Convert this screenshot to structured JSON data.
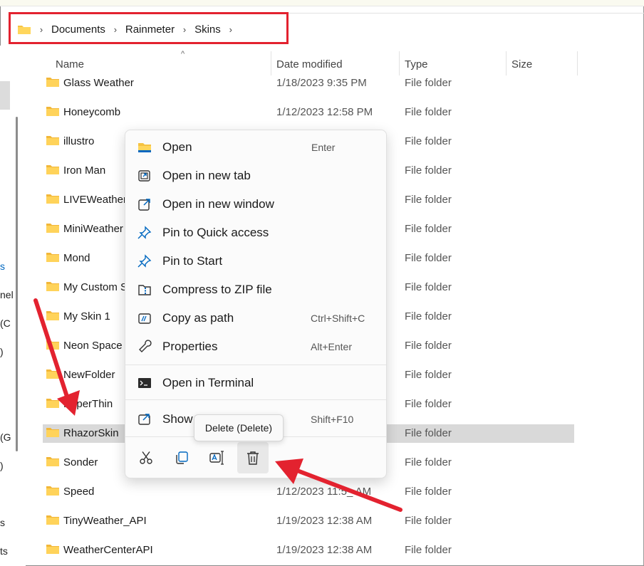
{
  "breadcrumb": {
    "items": [
      "Documents",
      "Rainmeter",
      "Skins"
    ]
  },
  "columns": {
    "name": "Name",
    "date": "Date modified",
    "type": "Type",
    "size": "Size"
  },
  "left_fragments": [
    "s",
    "nel",
    "(C",
    ")",
    "(G",
    ")",
    "s",
    "ts"
  ],
  "rows": [
    {
      "name": "Glass Weather",
      "date": "1/18/2023 9:35 PM",
      "type": "File folder"
    },
    {
      "name": "Honeycomb",
      "date": "1/12/2023 12:58 PM",
      "type": "File folder"
    },
    {
      "name": "illustro",
      "date": "",
      "type": "File folder"
    },
    {
      "name": "Iron Man",
      "date": "",
      "type": "File folder"
    },
    {
      "name": "LIVEWeather_",
      "date": "",
      "type": "File folder"
    },
    {
      "name": "MiniWeather",
      "date": "",
      "type": "File folder"
    },
    {
      "name": "Mond",
      "date": "",
      "type": "File folder"
    },
    {
      "name": "My Custom S",
      "date": "",
      "type": "File folder"
    },
    {
      "name": "My Skin 1",
      "date": "",
      "type": "File folder"
    },
    {
      "name": "Neon Space",
      "date": "",
      "type": "File folder"
    },
    {
      "name": "NewFolder",
      "date": "",
      "type": "File folder"
    },
    {
      "name": "PaperThin",
      "date": "",
      "type": "File folder"
    },
    {
      "name": "RhazorSkin",
      "date": "",
      "type": "File folder"
    },
    {
      "name": "Sonder",
      "date": "",
      "type": "File folder"
    },
    {
      "name": "Speed",
      "date": "1/12/2023 11:5_ AM",
      "type": "File folder"
    },
    {
      "name": "TinyWeather_API",
      "date": "1/19/2023 12:38 AM",
      "type": "File folder"
    },
    {
      "name": "WeatherCenterAPI",
      "date": "1/19/2023 12:38 AM",
      "type": "File folder"
    }
  ],
  "context_menu": {
    "items": [
      {
        "label": "Open",
        "shortcut": "Enter",
        "icon": "folder-open-icon"
      },
      {
        "label": "Open in new tab",
        "shortcut": "",
        "icon": "new-tab-icon"
      },
      {
        "label": "Open in new window",
        "shortcut": "",
        "icon": "new-window-icon"
      },
      {
        "label": "Pin to Quick access",
        "shortcut": "",
        "icon": "pin-icon"
      },
      {
        "label": "Pin to Start",
        "shortcut": "",
        "icon": "pin-icon"
      },
      {
        "label": "Compress to ZIP file",
        "shortcut": "",
        "icon": "zip-icon"
      },
      {
        "label": "Copy as path",
        "shortcut": "Ctrl+Shift+C",
        "icon": "copy-path-icon"
      },
      {
        "label": "Properties",
        "shortcut": "Alt+Enter",
        "icon": "wrench-icon"
      },
      {
        "label": "Open in Terminal",
        "shortcut": "",
        "icon": "terminal-icon"
      },
      {
        "label": "Show",
        "shortcut": "Shift+F10",
        "icon": "show-more-icon"
      }
    ],
    "actions": [
      "cut-icon",
      "copy-icon",
      "rename-icon",
      "delete-icon"
    ],
    "tooltip": "Delete (Delete)"
  },
  "colors": {
    "accent": "#0067c0",
    "annotation": "#e3222f",
    "folder": "#f5c342"
  }
}
